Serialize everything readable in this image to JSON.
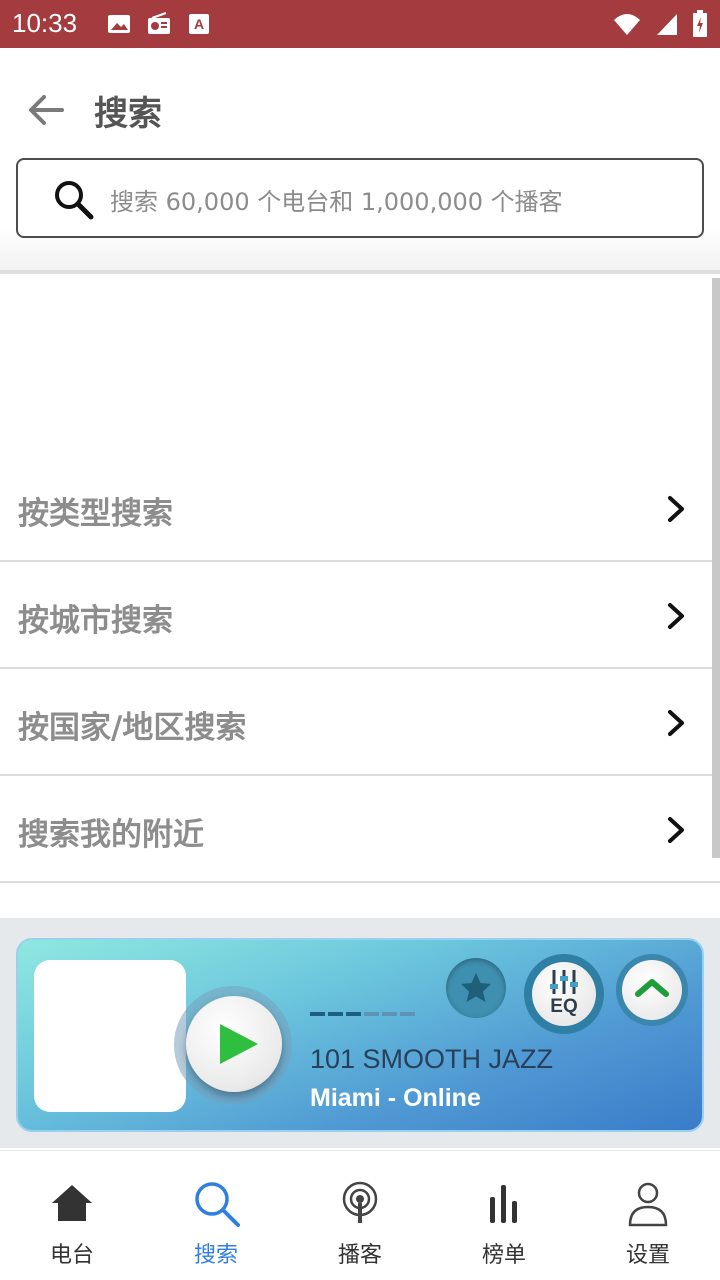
{
  "status_bar": {
    "time": "10:33",
    "left_icons": [
      "image-icon",
      "radio-icon",
      "font-icon"
    ],
    "right_icons": [
      "wifi-icon",
      "signal-icon",
      "battery-icon"
    ],
    "background": "#a33b3f"
  },
  "header": {
    "title": "搜索",
    "search_placeholder": "搜索 60,000 个电台和 1,000,000 个播客"
  },
  "list": {
    "items": [
      {
        "label": "按类型搜索"
      },
      {
        "label": "按城市搜索"
      },
      {
        "label": "按国家/地区搜索"
      },
      {
        "label": "搜索我的附近"
      }
    ]
  },
  "player": {
    "station_name": "101 SMOOTH JAZZ",
    "station_subtitle": "Miami - Online",
    "eq_label": "EQ",
    "accent": "#3a7cc9"
  },
  "bottom_nav": {
    "items": [
      {
        "label": "电台",
        "icon": "home-icon"
      },
      {
        "label": "搜索",
        "icon": "search-icon"
      },
      {
        "label": "播客",
        "icon": "podcast-icon"
      },
      {
        "label": "榜单",
        "icon": "chart-icon"
      },
      {
        "label": "设置",
        "icon": "user-icon"
      }
    ],
    "active_color": "#2f7fe0"
  }
}
